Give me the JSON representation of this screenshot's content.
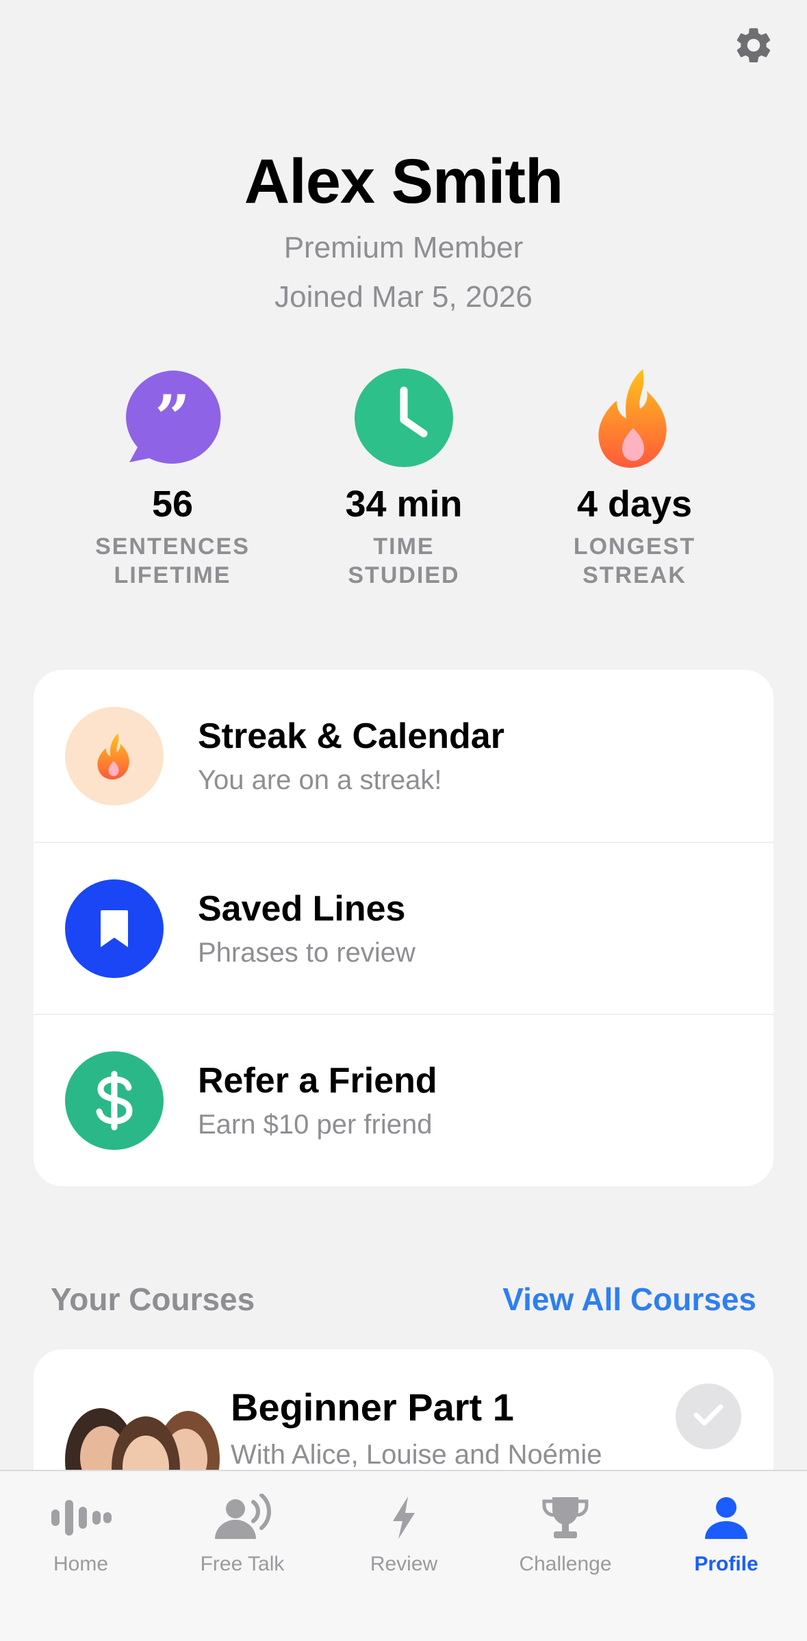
{
  "profile": {
    "name": "Alex Smith",
    "membership": "Premium Member",
    "joined": "Joined Mar 5, 2026"
  },
  "stats": [
    {
      "value": "56",
      "label_line1": "SENTENCES",
      "label_line2": "LIFETIME",
      "icon": "quote-bubble-icon",
      "color": "#8e63e6"
    },
    {
      "value": "34 min",
      "label_line1": "TIME",
      "label_line2": "STUDIED",
      "icon": "clock-icon",
      "color": "#2ec08a"
    },
    {
      "value": "4 days",
      "label_line1": "LONGEST",
      "label_line2": "STREAK",
      "icon": "flame-icon",
      "color": "#ff8a1f"
    }
  ],
  "menu": [
    {
      "title": "Streak & Calendar",
      "subtitle": "You are on a streak!",
      "icon": "flame-icon",
      "color": "#fde3cc"
    },
    {
      "title": "Saved Lines",
      "subtitle": "Phrases to review",
      "icon": "bookmark-icon",
      "color": "#1a46f5"
    },
    {
      "title": "Refer a Friend",
      "subtitle": "Earn $10 per friend",
      "icon": "dollar-icon",
      "color": "#2ab888"
    }
  ],
  "courses": {
    "section_title": "Your Courses",
    "view_all": "View All Courses",
    "items": [
      {
        "title": "Beginner Part 1",
        "subtitle": "With Alice, Louise and Noémie",
        "completed": true
      }
    ]
  },
  "tabbar": {
    "tabs": [
      {
        "label": "Home",
        "icon": "waveform-icon",
        "active": false
      },
      {
        "label": "Free Talk",
        "icon": "person-speaking-icon",
        "active": false
      },
      {
        "label": "Review",
        "icon": "lightning-icon",
        "active": false
      },
      {
        "label": "Challenge",
        "icon": "trophy-icon",
        "active": false
      },
      {
        "label": "Profile",
        "icon": "person-icon",
        "active": true
      }
    ]
  },
  "colors": {
    "background": "#f2f2f2",
    "accent_blue": "#2f7ef0",
    "tab_active": "#1a5cff",
    "secondary_text": "#8e8e93"
  }
}
